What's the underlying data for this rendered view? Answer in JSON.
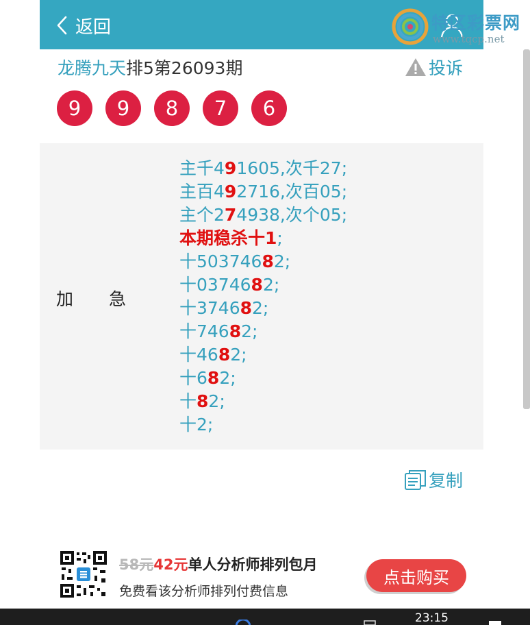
{
  "header": {
    "back_label": "返回"
  },
  "logo": {
    "title": "特区彩票网",
    "url": "www.tqcp.net"
  },
  "post": {
    "author": "龙腾九天",
    "title_rest": "排5第26093期",
    "complain_label": "投诉"
  },
  "balls": [
    "9",
    "9",
    "8",
    "7",
    "6"
  ],
  "panel": {
    "label_a": "加",
    "label_b": "急",
    "lines": [
      [
        {
          "t": "主千4"
        },
        {
          "t": "9",
          "hl": true
        },
        {
          "t": "1605,次千27;"
        }
      ],
      [
        {
          "t": "主百4"
        },
        {
          "t": "9",
          "hl": true
        },
        {
          "t": "2716,次百05;"
        }
      ],
      [
        {
          "t": "主个2"
        },
        {
          "t": "7",
          "hl": true
        },
        {
          "t": "4938,次个05;"
        }
      ],
      [
        {
          "t": "本期稳杀十1",
          "hl": true
        },
        {
          "t": ";"
        }
      ],
      [
        {
          "t": "十503746"
        },
        {
          "t": "8",
          "hl": true
        },
        {
          "t": "2;"
        }
      ],
      [
        {
          "t": "十03746"
        },
        {
          "t": "8",
          "hl": true
        },
        {
          "t": "2;"
        }
      ],
      [
        {
          "t": "十3746"
        },
        {
          "t": "8",
          "hl": true
        },
        {
          "t": "2;"
        }
      ],
      [
        {
          "t": "十746"
        },
        {
          "t": "8",
          "hl": true
        },
        {
          "t": "2;"
        }
      ],
      [
        {
          "t": "十46"
        },
        {
          "t": "8",
          "hl": true
        },
        {
          "t": "2;"
        }
      ],
      [
        {
          "t": "十6"
        },
        {
          "t": "8",
          "hl": true
        },
        {
          "t": "2;"
        }
      ],
      [
        {
          "t": "十"
        },
        {
          "t": "8",
          "hl": true
        },
        {
          "t": "2;"
        }
      ],
      [
        {
          "t": "十2;"
        }
      ]
    ]
  },
  "copy_label": "复制",
  "promo": {
    "old_price": "58元",
    "new_price": "42元",
    "title": "单人分析师排列包月",
    "subtitle": "免费看该分析师排列付费信息",
    "buy_label": "点击购买"
  },
  "taskbar": {
    "time": "23:15"
  },
  "colors": {
    "header_bg": "#35a7c1",
    "ball_red": "#dc2042",
    "accent_text": "#35a0bd",
    "highlight_red": "#e01010",
    "buy_button": "#e84545"
  }
}
